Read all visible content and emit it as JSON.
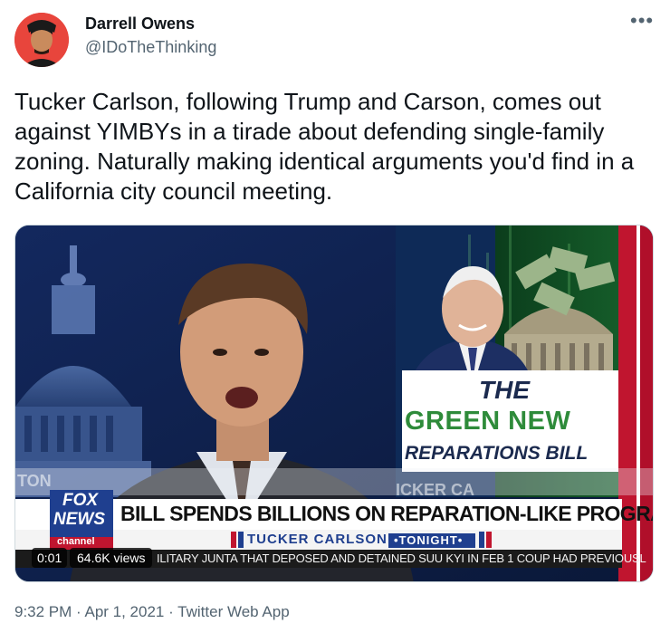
{
  "tweet": {
    "author_name": "Darrell Owens",
    "author_handle": "@IDoTheThinking",
    "more_icon": "more-horizontal-icon",
    "text": "Tucker Carlson, following Trump and Carson, comes out against YIMBYs in a tirade about defending single-family zoning. Naturally making identical arguments you'd find in a California city council meeting.",
    "timestamp": "9:32 PM · Apr 1, 2021 · Twitter Web App"
  },
  "video": {
    "time": "0:01",
    "views": "64.6K views",
    "graphic": {
      "line1": "THE",
      "line2": "GREEN NEW",
      "line3": "REPARATIONS BILL"
    },
    "lower_third": {
      "network_line1": "FOX",
      "network_line2": "NEWS",
      "network_line3": "channel",
      "headline": "BILL SPENDS BILLIONS ON REPARATION-LIKE PROGRAMS",
      "show_name": "TUCKER CARLSON",
      "show_tag": "•TONIGHT•",
      "ticker": "ILITARY JUNTA THAT DEPOSED AND DETAINED SUU KYI IN FEB 1 COUP HAD PREVIOUSL",
      "bg_text_left": "TON",
      "bg_text_right": "ICKER CA"
    }
  },
  "colors": {
    "text_primary": "#0f1419",
    "text_secondary": "#536471",
    "fox_blue": "#1f3f8f",
    "green": "#2e8b3a",
    "red": "#c0152f"
  }
}
